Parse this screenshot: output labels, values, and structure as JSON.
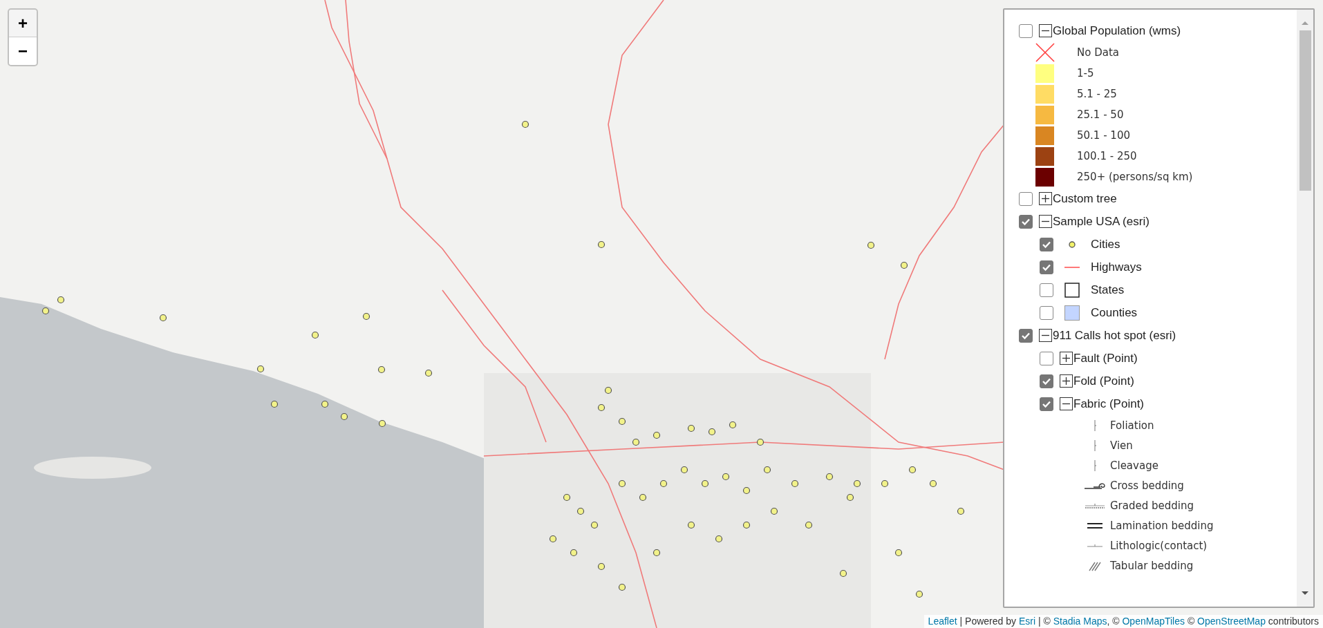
{
  "zoom_controls": [
    {
      "label": "+"
    },
    {
      "label": "−"
    }
  ],
  "layers": [
    {
      "label": "Global Population (wms)",
      "checked": false,
      "expanded": true,
      "legend": [
        {
          "kind": "cross",
          "label": "No Data",
          "color": "#ff4040"
        },
        {
          "kind": "swatch",
          "label": "1-5",
          "color": "#ffff80"
        },
        {
          "kind": "swatch",
          "label": "5.1 - 25",
          "color": "#ffdc64"
        },
        {
          "kind": "swatch",
          "label": "25.1 - 50",
          "color": "#f6b941"
        },
        {
          "kind": "swatch",
          "label": "50.1 - 100",
          "color": "#d98622"
        },
        {
          "kind": "swatch",
          "label": "100.1 - 250",
          "color": "#9c4212"
        },
        {
          "kind": "swatch",
          "label": "250+ (persons/sq km)",
          "color": "#6b0000"
        }
      ]
    },
    {
      "label": "Custom tree",
      "checked": false,
      "expanded": false
    },
    {
      "label": "Sample USA (esri)",
      "checked": true,
      "expanded": true,
      "children": [
        {
          "label": "Cities",
          "checked": true,
          "kind": "point"
        },
        {
          "label": "Highways",
          "checked": true,
          "kind": "line"
        },
        {
          "label": "States",
          "checked": false,
          "kind": "outline"
        },
        {
          "label": "Counties",
          "checked": false,
          "kind": "fill"
        }
      ]
    },
    {
      "label": "911 Calls hot spot (esri)",
      "checked": true,
      "expanded": true,
      "children": [
        {
          "label": "Fault (Point)",
          "checked": false,
          "expanded": false
        },
        {
          "label": "Fold (Point)",
          "checked": true,
          "expanded": false
        },
        {
          "label": "Fabric (Point)",
          "checked": true,
          "expanded": true,
          "legend": [
            {
              "kind": "tick",
              "label": "Foliation"
            },
            {
              "kind": "tick",
              "label": "Vien"
            },
            {
              "kind": "tick",
              "label": "Cleavage"
            },
            {
              "kind": "cross-bedding",
              "label": "Cross bedding"
            },
            {
              "kind": "graded",
              "label": "Graded bedding"
            },
            {
              "kind": "lamination",
              "label": "Lamination bedding"
            },
            {
              "kind": "lithologic",
              "label": "Lithologic(contact)"
            },
            {
              "kind": "tabular",
              "label": "Tabular bedding"
            }
          ]
        }
      ]
    }
  ],
  "attribution": [
    {
      "text": "Leaflet",
      "link": true
    },
    {
      "text": " | Powered by ",
      "link": false
    },
    {
      "text": "Esri",
      "link": true
    },
    {
      "text": " | © ",
      "link": false
    },
    {
      "text": "Stadia Maps",
      "link": true
    },
    {
      "text": ", © ",
      "link": false
    },
    {
      "text": "OpenMapTiles",
      "link": true
    },
    {
      "text": " © ",
      "link": false
    },
    {
      "text": "OpenStreetMap",
      "link": true
    },
    {
      "text": " contributors",
      "link": false
    }
  ]
}
